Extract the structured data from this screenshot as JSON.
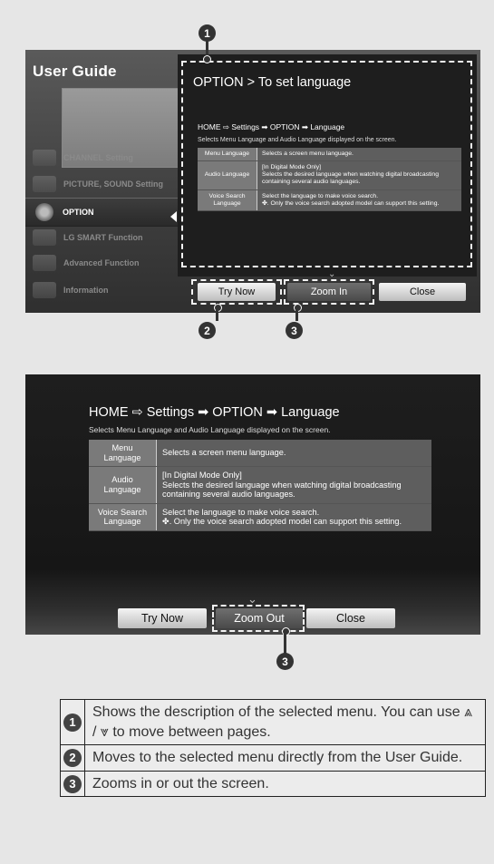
{
  "screen1": {
    "title": "User Guide",
    "menu_items": [
      {
        "label": "CHANNEL Setting"
      },
      {
        "label": "PICTURE, SOUND Setting"
      },
      {
        "label": "OPTION"
      },
      {
        "label": "LG SMART Function"
      },
      {
        "label": "Advanced Function"
      },
      {
        "label": "Information"
      }
    ],
    "selected_item": "OPTION",
    "panel_title": "OPTION > To set language",
    "path": "HOME ⇨ Settings ➡ OPTION ➡ Language",
    "description": "Selects Menu Language and Audio Language displayed on the screen.",
    "buttons": {
      "try_now": "Try Now",
      "zoom": "Zoom In",
      "close": "Close"
    }
  },
  "language_table": [
    {
      "label": "Menu Language",
      "value": "Selects a screen menu language.",
      "note": ""
    },
    {
      "label": "Audio Language",
      "value": "[In Digital Mode Only]",
      "note": "Selects the desired language when watching digital broadcasting containing several audio languages."
    },
    {
      "label": "Voice Search Language",
      "value": "Select the language to make voice search.",
      "note": "✤. Only the voice search adopted model can support this setting."
    }
  ],
  "screen2": {
    "path": "HOME ⇨ Settings ➡ OPTION ➡ Language",
    "description": "Selects Menu Language and Audio Language displayed on the screen.",
    "buttons": {
      "try_now": "Try Now",
      "zoom": "Zoom Out",
      "close": "Close"
    }
  },
  "markers": {
    "one": "1",
    "two": "2",
    "three": "3"
  },
  "legend": [
    {
      "num": "1",
      "text": "Shows the description of the selected menu. You can use ⩓ / ⩔ to move between pages."
    },
    {
      "num": "2",
      "text": "Moves to the selected menu directly from the User Guide."
    },
    {
      "num": "3",
      "text": "Zooms in or out the screen."
    }
  ]
}
